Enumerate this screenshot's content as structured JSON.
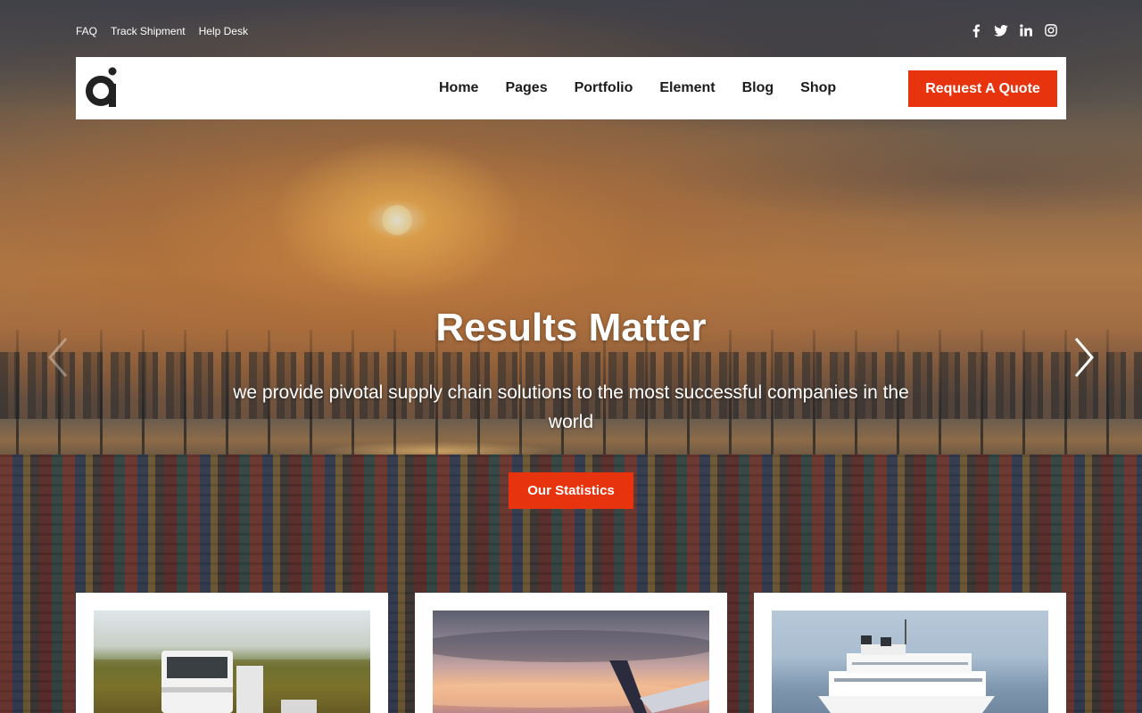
{
  "topbar": {
    "links": [
      "FAQ",
      "Track Shipment",
      "Help Desk"
    ],
    "social": [
      "facebook-icon",
      "twitter-icon",
      "linkedin-icon",
      "instagram-icon"
    ]
  },
  "navbar": {
    "logo": "logo-icon",
    "menu": [
      "Home",
      "Pages",
      "Portfolio",
      "Element",
      "Blog",
      "Shop"
    ],
    "cta_label": "Request A Quote"
  },
  "hero": {
    "title": "Results Matter",
    "subtitle": "we provide pivotal supply chain solutions to the most successful companies in the world",
    "button_label": "Our Statistics",
    "prev_icon": "chevron-left-icon",
    "next_icon": "chevron-right-icon"
  },
  "cards": [
    {
      "image": "truck-image"
    },
    {
      "image": "airplane-image"
    },
    {
      "image": "cruise-ship-image"
    }
  ],
  "colors": {
    "accent": "#e8330f",
    "nav_bg": "#ffffff",
    "nav_text": "#1c1c1c",
    "hero_text": "#ffffff"
  }
}
